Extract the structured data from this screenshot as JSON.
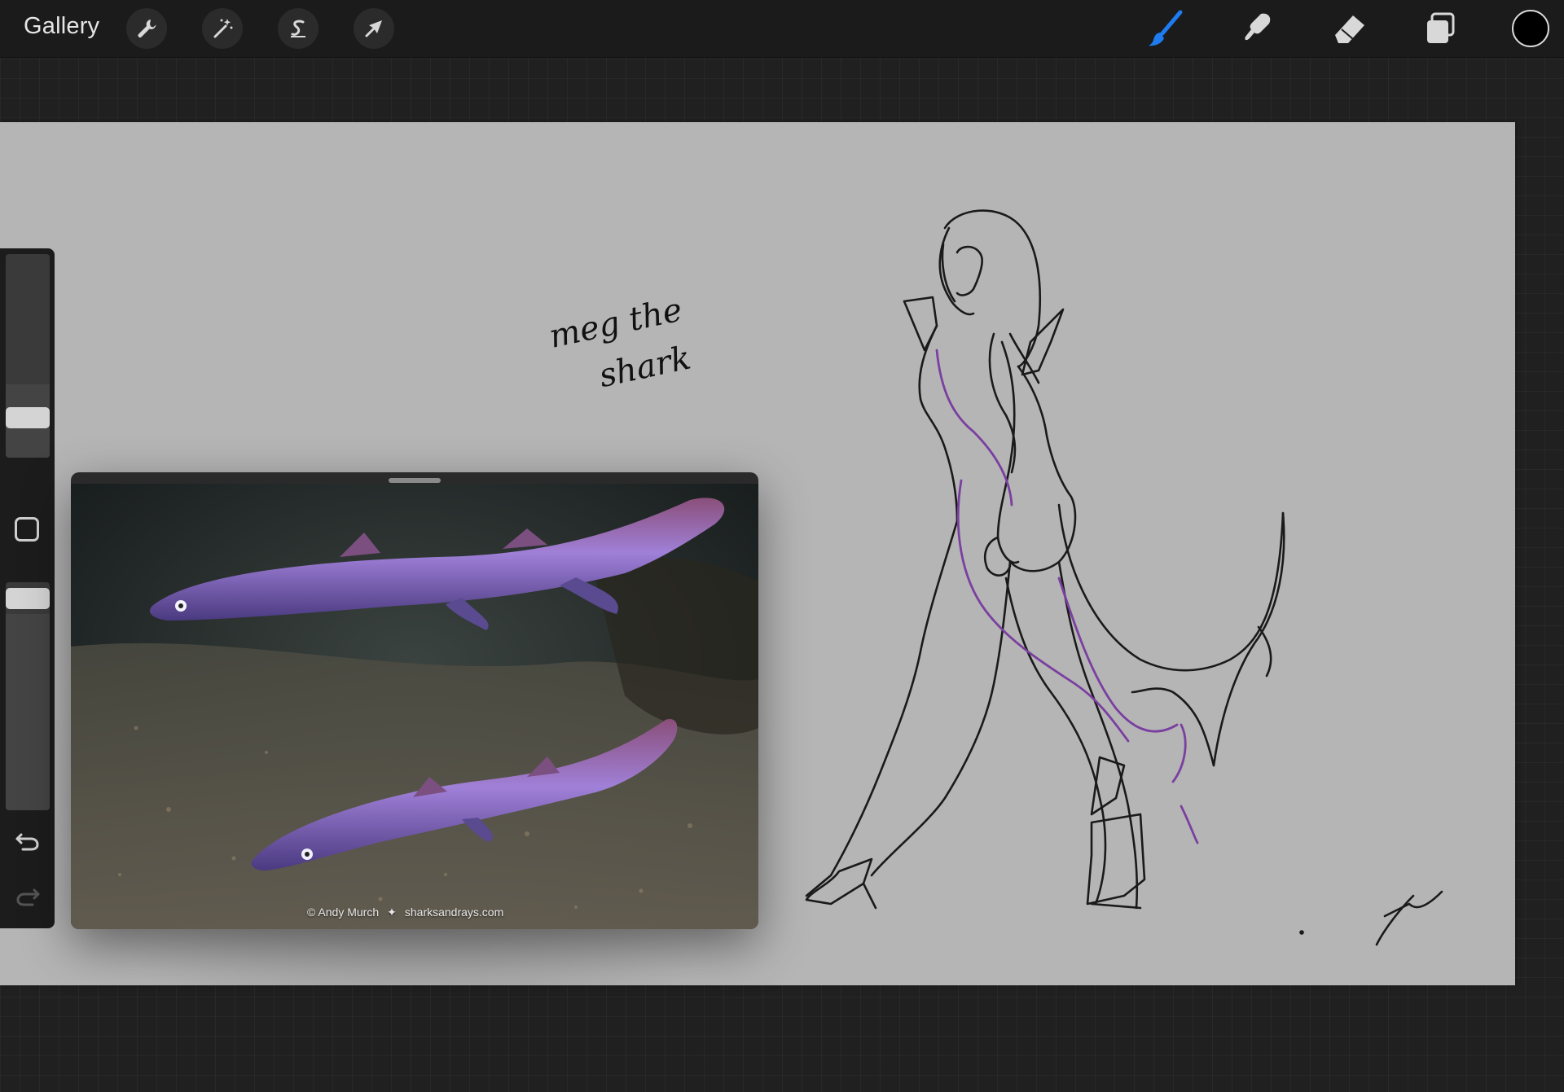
{
  "toolbar": {
    "gallery_label": "Gallery",
    "left_tools": [
      {
        "name": "actions",
        "icon": "wrench-icon"
      },
      {
        "name": "adjustments",
        "icon": "magic-wand-icon"
      },
      {
        "name": "selection",
        "icon": "selection-s-icon"
      },
      {
        "name": "transform",
        "icon": "arrow-cursor-icon"
      }
    ],
    "right_tools": [
      {
        "name": "brush",
        "icon": "brush-icon",
        "active": true
      },
      {
        "name": "smudge",
        "icon": "smudge-icon",
        "active": false
      },
      {
        "name": "eraser",
        "icon": "eraser-icon",
        "active": false
      },
      {
        "name": "layers",
        "icon": "layers-icon",
        "active": false
      }
    ],
    "current_color": "#000000",
    "active_tool_color": "#1e7cf0"
  },
  "sidebar": {
    "brush_size": 0.36,
    "opacity": 0.14,
    "modify_icon": "square-icon",
    "undo_icon": "undo-icon",
    "redo_icon": "redo-icon"
  },
  "canvas": {
    "background_color": "#b5b5b5",
    "handwritten_note": [
      "meg the",
      "shark"
    ],
    "sketch_description_colors": {
      "line": "#1a1a1a",
      "accent": "#7a3fa0"
    }
  },
  "reference": {
    "credit": "© Andy Murch",
    "site": "sharksandrays.com"
  }
}
